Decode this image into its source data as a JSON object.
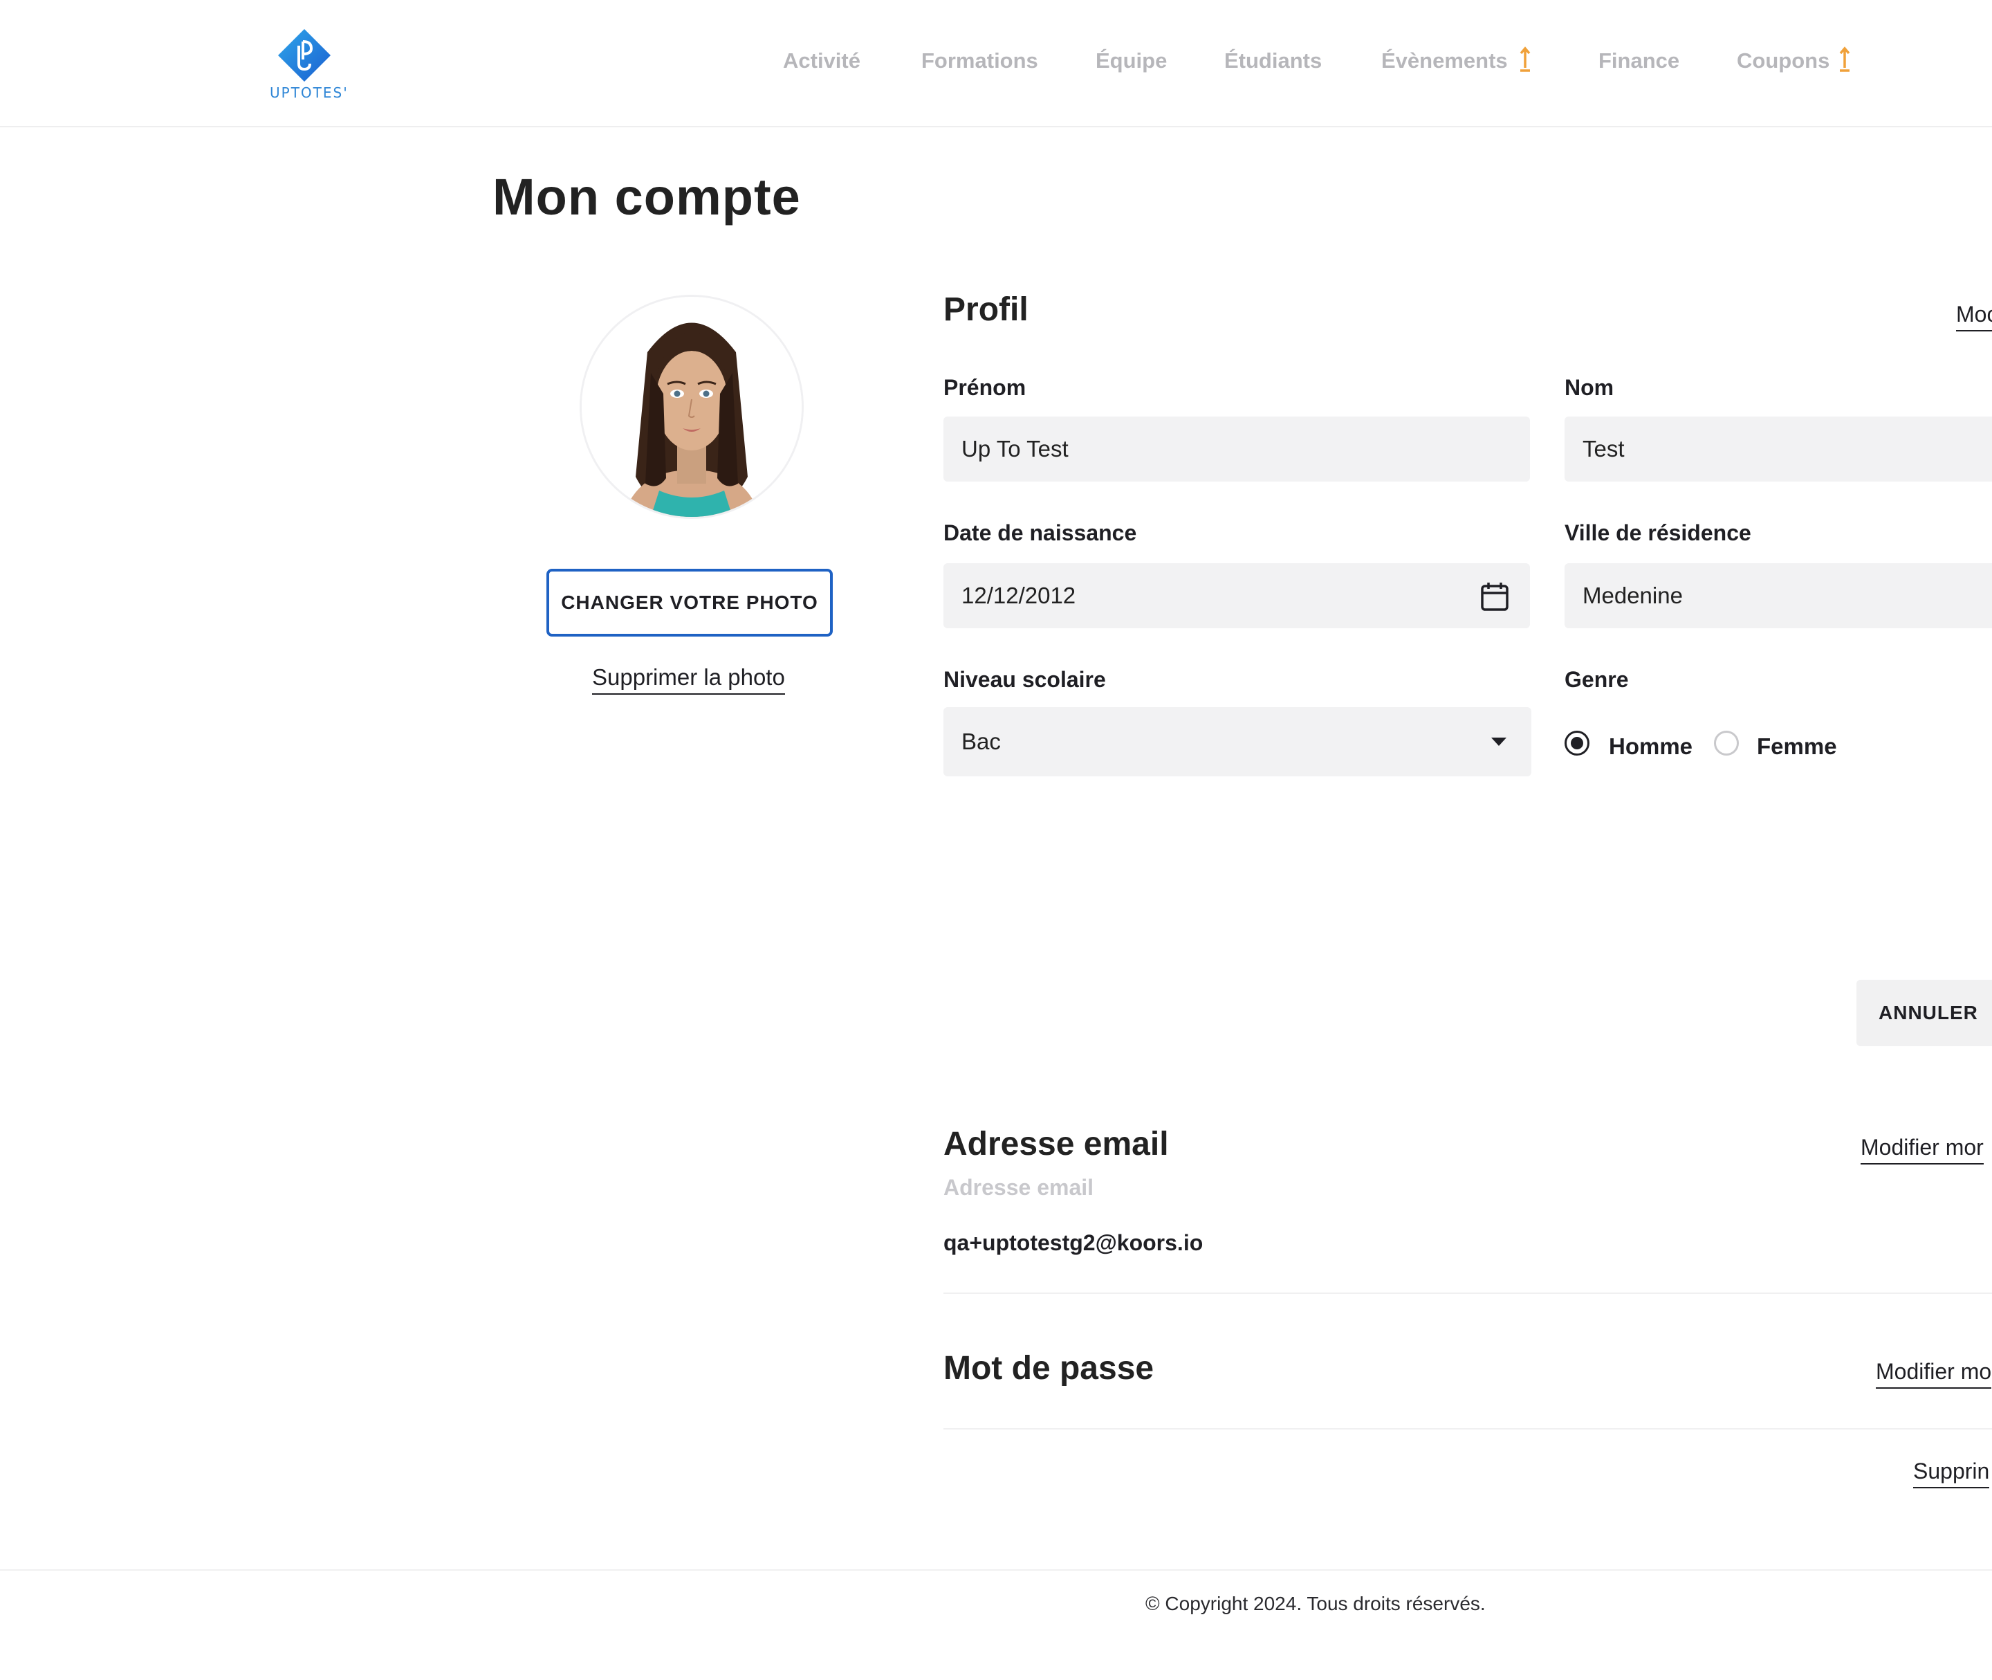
{
  "header": {
    "logo_text": "UPTOTES'",
    "nav": [
      "Activité",
      "Formations",
      "Équipe",
      "Étudiants",
      "Évènements",
      "Finance",
      "Coupons"
    ]
  },
  "page": {
    "title": "Mon compte"
  },
  "avatar": {
    "change_label": "CHANGER VOTRE PHOTO",
    "delete_label": "Supprimer la photo"
  },
  "profile": {
    "title": "Profil",
    "edit_link": "Moc",
    "first_name": {
      "label": "Prénom",
      "value": "Up To Test"
    },
    "last_name": {
      "label": "Nom",
      "value": "Test"
    },
    "birth_date": {
      "label": "Date de naissance",
      "value": "12/12/2012"
    },
    "city": {
      "label": "Ville de résidence",
      "value": "Medenine"
    },
    "school_level": {
      "label": "Niveau scolaire",
      "value": "Bac"
    },
    "gender": {
      "label": "Genre",
      "options": [
        "Homme",
        "Femme"
      ],
      "selected": "Homme"
    },
    "cancel_label": "ANNULER"
  },
  "email": {
    "title": "Adresse email",
    "sublabel": "Adresse email",
    "value": "qa+uptotestg2@koors.io",
    "edit_link": "Modifier mor"
  },
  "password": {
    "title": "Mot de passe",
    "edit_link": "Modifier mo"
  },
  "delete_account_link": "Supprin",
  "footer": {
    "copyright": "© Copyright 2024. Tous droits réservés."
  },
  "colors": {
    "accent": "#1f62c4",
    "nav_muted": "#b6b6ba",
    "notify": "#f0a13a",
    "field_bg": "#f2f2f3"
  }
}
